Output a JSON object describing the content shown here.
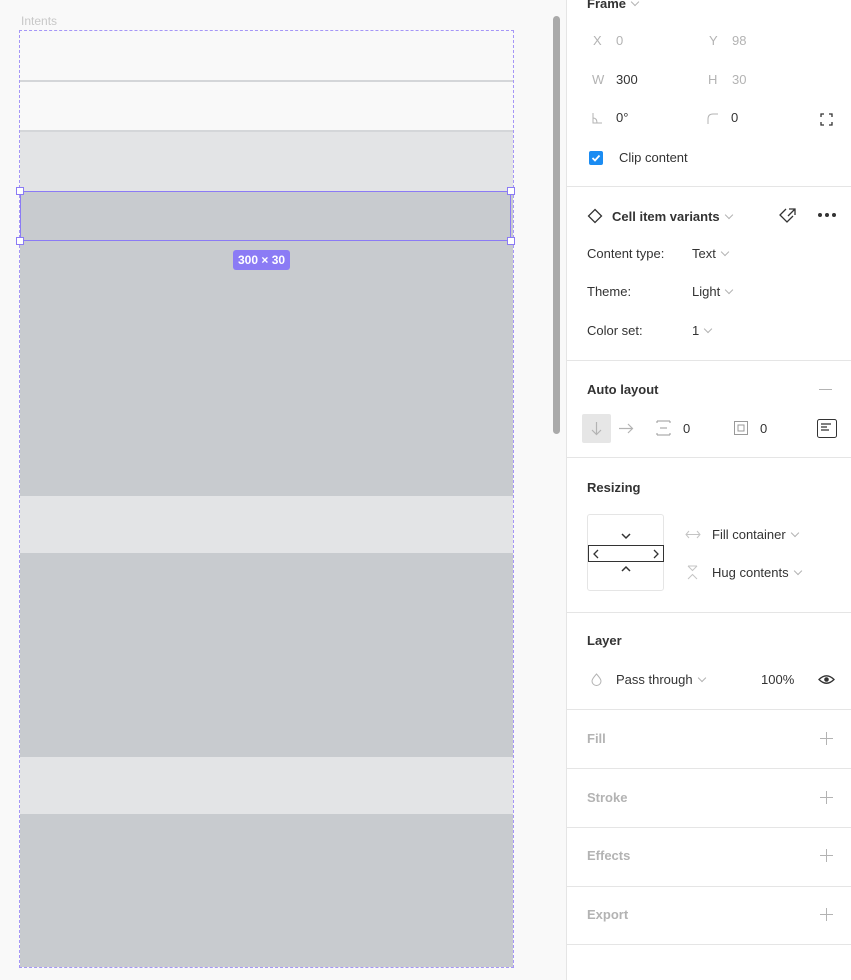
{
  "canvas": {
    "frame_label": "Intents",
    "selection_size_badge": "300 × 30",
    "colors": {
      "selection": "#8b7bf5",
      "band_white": "#f9f9f9",
      "band_light": "#e3e4e6",
      "band_mid": "#c8cbcf"
    }
  },
  "panel": {
    "frame": {
      "title": "Frame",
      "x_label": "X",
      "x_value": "0",
      "y_label": "Y",
      "y_value": "98",
      "w_label": "W",
      "w_value": "300",
      "h_label": "H",
      "h_value": "30",
      "rotation_value": "0°",
      "radius_value": "0",
      "clip_content_label": "Clip content",
      "clip_content_checked": true
    },
    "component": {
      "title": "Cell item variants",
      "properties": [
        {
          "label": "Content type:",
          "value": "Text"
        },
        {
          "label": "Theme:",
          "value": "Light"
        },
        {
          "label": "Color set:",
          "value": "1"
        }
      ]
    },
    "auto_layout": {
      "title": "Auto layout",
      "spacing_value": "0",
      "padding_value": "0"
    },
    "resizing": {
      "title": "Resizing",
      "horizontal": "Fill container",
      "vertical": "Hug contents"
    },
    "layer": {
      "title": "Layer",
      "blend_mode": "Pass through",
      "opacity": "100%"
    },
    "fill": {
      "title": "Fill"
    },
    "stroke": {
      "title": "Stroke"
    },
    "effects": {
      "title": "Effects"
    },
    "export": {
      "title": "Export"
    }
  }
}
